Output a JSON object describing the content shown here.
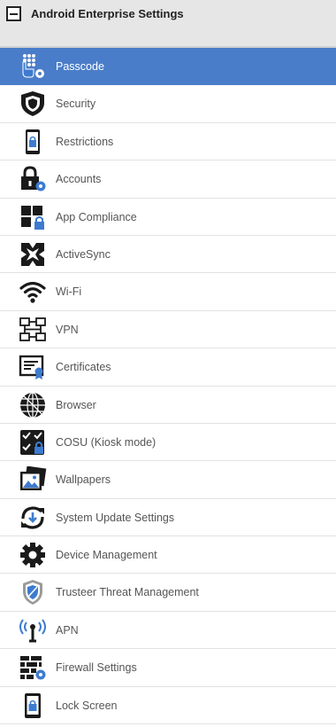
{
  "header": {
    "title": "Android Enterprise Settings"
  },
  "colors": {
    "active_bg": "#4a7dc9",
    "accent_blue": "#3d7bd0"
  },
  "menu": {
    "items": [
      {
        "label": "Passcode",
        "icon": "passcode-icon",
        "active": true
      },
      {
        "label": "Security",
        "icon": "shield-icon"
      },
      {
        "label": "Restrictions",
        "icon": "phone-lock-icon"
      },
      {
        "label": "Accounts",
        "icon": "lock-gear-icon"
      },
      {
        "label": "App Compliance",
        "icon": "app-grid-lock-icon"
      },
      {
        "label": "ActiveSync",
        "icon": "activesync-icon"
      },
      {
        "label": "Wi-Fi",
        "icon": "wifi-icon"
      },
      {
        "label": "VPN",
        "icon": "network-icon"
      },
      {
        "label": "Certificates",
        "icon": "certificate-icon"
      },
      {
        "label": "Browser",
        "icon": "globe-icon"
      },
      {
        "label": "COSU (Kiosk mode)",
        "icon": "kiosk-icon"
      },
      {
        "label": "Wallpapers",
        "icon": "wallpaper-icon"
      },
      {
        "label": "System Update Settings",
        "icon": "sync-icon"
      },
      {
        "label": "Device Management",
        "icon": "gear-icon"
      },
      {
        "label": "Trusteer Threat Management",
        "icon": "trusteer-shield-icon"
      },
      {
        "label": "APN",
        "icon": "antenna-icon"
      },
      {
        "label": "Firewall Settings",
        "icon": "firewall-icon"
      },
      {
        "label": "Lock Screen",
        "icon": "lock-screen-icon"
      }
    ]
  }
}
